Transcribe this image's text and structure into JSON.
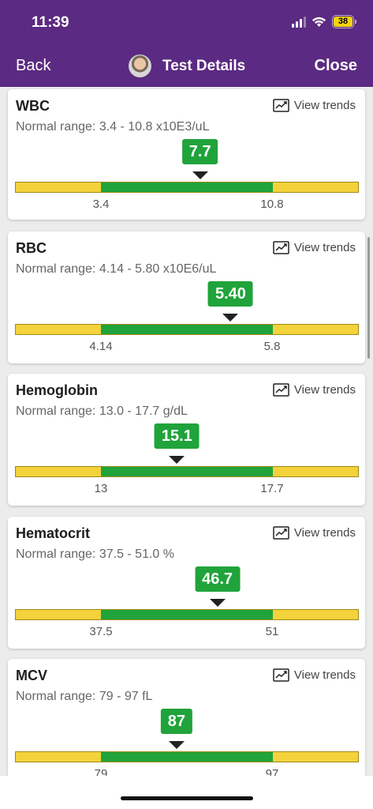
{
  "status_bar": {
    "time": "11:39",
    "battery": "38"
  },
  "header": {
    "back_label": "Back",
    "title": "Test Details",
    "close_label": "Close"
  },
  "colors": {
    "header": "#5b2a82",
    "normal": "#20a33b",
    "out_of_range": "#f3d23b"
  },
  "view_trends_label": "View trends",
  "tests": [
    {
      "name": "WBC",
      "range_text": "Normal range: 3.4 - 10.8 x10E3/uL",
      "value": "7.7",
      "low": "3.4",
      "high": "10.8",
      "low_num": 3.4,
      "high_num": 10.8,
      "value_num": 7.7
    },
    {
      "name": "RBC",
      "range_text": "Normal range: 4.14 - 5.80 x10E6/uL",
      "value": "5.40",
      "low": "4.14",
      "high": "5.8",
      "low_num": 4.14,
      "high_num": 5.8,
      "value_num": 5.4
    },
    {
      "name": "Hemoglobin",
      "range_text": "Normal range: 13.0 - 17.7 g/dL",
      "value": "15.1",
      "low": "13",
      "high": "17.7",
      "low_num": 13.0,
      "high_num": 17.7,
      "value_num": 15.1
    },
    {
      "name": "Hematocrit",
      "range_text": "Normal range: 37.5 - 51.0 %",
      "value": "46.7",
      "low": "37.5",
      "high": "51",
      "low_num": 37.5,
      "high_num": 51.0,
      "value_num": 46.7
    },
    {
      "name": "MCV",
      "range_text": "Normal range: 79 - 97 fL",
      "value": "87",
      "low": "79",
      "high": "97",
      "low_num": 79,
      "high_num": 97,
      "value_num": 87
    }
  ]
}
